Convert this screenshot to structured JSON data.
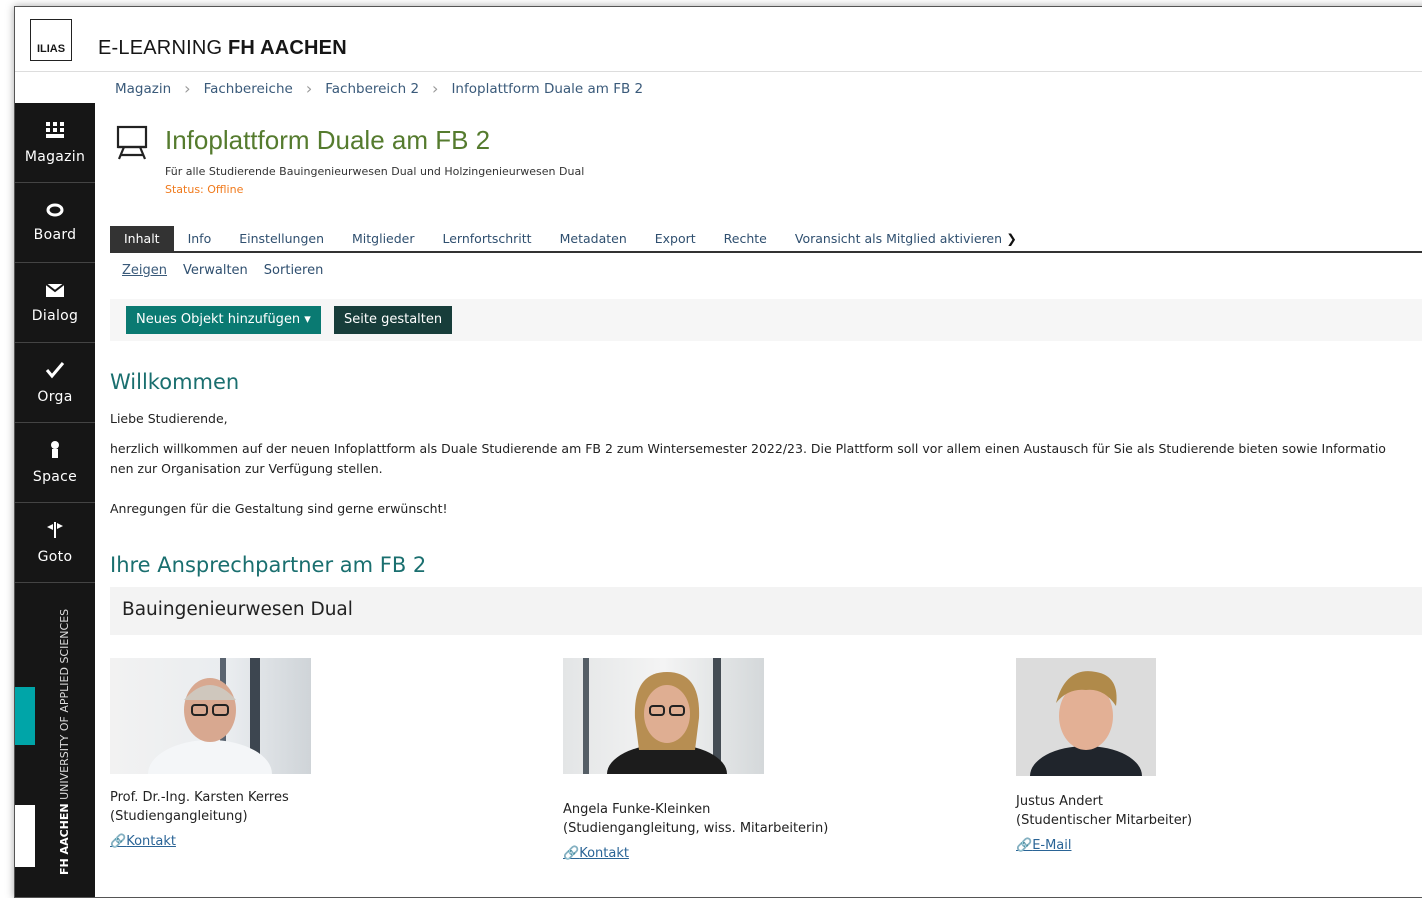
{
  "header": {
    "logo_text": "ILIAS",
    "app_title_prefix": "E-LEARNING",
    "app_title_bold": "FH AACHEN"
  },
  "breadcrumb": [
    "Magazin",
    "Fachbereiche",
    "Fachbereich 2",
    "Infoplattform Duale am FB 2"
  ],
  "sidebar": {
    "items": [
      {
        "label": "Magazin",
        "icon": "grid-icon"
      },
      {
        "label": "Board",
        "icon": "ring-icon"
      },
      {
        "label": "Dialog",
        "icon": "envelope-icon"
      },
      {
        "label": "Orga",
        "icon": "checkmark-icon"
      },
      {
        "label": "Space",
        "icon": "person-icon"
      },
      {
        "label": "Goto",
        "icon": "signpost-icon"
      }
    ],
    "brand_bold": "FH AACHEN",
    "brand_sub": "UNIVERSITY OF APPLIED SCIENCES"
  },
  "object": {
    "icon": "easel-icon",
    "title": "Infoplattform Duale am FB 2",
    "description": "Für alle Studierende Bauingenieurwesen Dual und Holzingenieurwesen Dual",
    "status": "Status: Offline"
  },
  "tabs": [
    "Inhalt",
    "Info",
    "Einstellungen",
    "Mitglieder",
    "Lernfortschritt",
    "Metadaten",
    "Export",
    "Rechte",
    "Voransicht als Mitglied aktivieren"
  ],
  "subtabs": [
    "Zeigen",
    "Verwalten",
    "Sortieren"
  ],
  "toolbar": {
    "add_label": "Neues Objekt hinzufügen ▾",
    "design_label": "Seite gestalten"
  },
  "welcome": {
    "heading": "Willkommen",
    "greeting": "Liebe Studierende,",
    "line1": "herzlich willkommen auf der neuen Infoplattform als Duale Studierende am FB 2 zum Wintersemester 2022/23. Die Plattform soll vor allem einen Austausch für Sie als Studierende bieten sowie Informatio",
    "line2": "nen zur Organisation zur Verfügung stellen.",
    "line3": "Anregungen für die Gestaltung sind gerne erwünscht!"
  },
  "contacts": {
    "heading": "Ihre Ansprechpartner am FB 2",
    "accordion_title": "Bauingenieurwesen Dual",
    "people": [
      {
        "name": "Prof. Dr.-Ing. Karsten Kerres",
        "role": "(Studiengangleitung)",
        "link": "Kontakt",
        "link_icon": "link-icon"
      },
      {
        "name": "Angela Funke-Kleinken",
        "role": "(Studiengangleitung, wiss. Mitarbeiterin)",
        "link": "Kontakt",
        "link_icon": "link-icon"
      },
      {
        "name": "Justus Andert",
        "role": "(Studentischer Mitarbeiter)",
        "link": "E-Mail",
        "link_icon": "link-icon"
      }
    ]
  },
  "colors": {
    "title_green": "#557b2e",
    "heading_teal": "#1a6f6f",
    "primary_button": "#0a7a72",
    "sidebar_bg": "#161616",
    "status_orange": "#f07a1c"
  }
}
